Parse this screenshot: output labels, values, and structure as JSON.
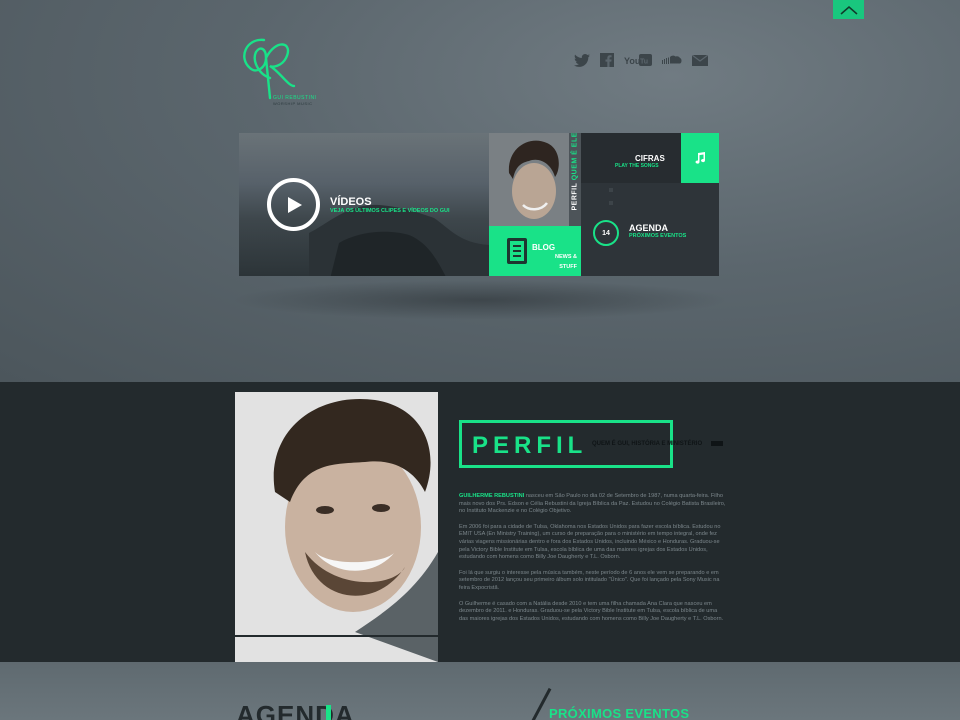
{
  "brand": {
    "logo_monogram": "GR",
    "name": "GUI REBUSTINI",
    "tagline": "WORSHIP MUSIC"
  },
  "social": [
    "twitter-icon",
    "facebook-icon",
    "youtube-icon",
    "soundcloud-icon",
    "mail-icon"
  ],
  "colors": {
    "accent": "#19e288",
    "dark": "#232a2d",
    "hero": "#5b666d"
  },
  "tiles": {
    "videos": {
      "title": "VÍDEOS",
      "subtitle": "VEJA OS ÚLTIMOS CLIPES E VÍDEOS DO GUI"
    },
    "perfil": {
      "label": "PERFIL",
      "label_accent": "QUEM É ELE"
    },
    "blog": {
      "title": "BLOG",
      "subtitle_1": "NEWS &",
      "subtitle_2": "STUFF"
    },
    "cifras": {
      "title": "CIFRAS",
      "subtitle": "PLAY THE SONGS"
    },
    "agenda": {
      "badge": "14",
      "title": "AGENDA",
      "subtitle": "PRÓXIMOS EVENTOS"
    }
  },
  "profile": {
    "heading": "PERFIL",
    "tagline": "QUEM É GUI, HISTÓRIA E MINISTÉRIO",
    "bio": [
      {
        "highlight": "GUILHERME REBUSTINI",
        "text": " nasceu em São Paulo no dia 02 de Setembro de 1987, numa quarta-feira. Filho mais novo dos Prs. Edson e Célia Rebustini da Igreja Bíblica da Paz. Estudou no Colégio Batista Brasileiro, no Instituto Mackenzie e no Colégio Objetivo."
      },
      {
        "highlight": "",
        "text": "Em 2006 foi para a cidade de Tulsa, Oklahoma nos Estados Unidos para fazer escola bíblica. Estudou no EMIT USA (En Ministry Training), um curso de preparação para o ministério em tempo integral, onde fez várias viagens missionárias dentro e fora dos Estados Unidos, incluindo México e Honduras. Graduou-se pela Victory Bible Institute em Tulsa, escola bíblica de uma das maiores igrejas dos Estados Unidos, estudando com homens como Billy Joe Daugherty e T.L. Osborn."
      },
      {
        "highlight": "",
        "text": "Foi lá que surgiu o interesse pela música também, neste período de 6 anos ele vem se preparando e em setembro de 2012 lançou seu primeiro álbum solo intitulado \"Único\". Que foi lançado pela Sony Music na feira Expocristã."
      },
      {
        "highlight": "",
        "text": "O Guilherme é casado com a Natália desde 2010 e tem uma filha chamada Ana Clara que nasceu em dezembro de 2011. e Honduras. Graduou-se pela Victory Bible Institute em Tulsa, escola bíblica de uma das maiores igrejas dos Estados Unidos, estudando com homens como Billy Joe Daugherty e T.L. Osborn."
      }
    ]
  },
  "agenda_section": {
    "heading": "AGENDA",
    "subheading": "PRÓXIMOS EVENTOS"
  }
}
